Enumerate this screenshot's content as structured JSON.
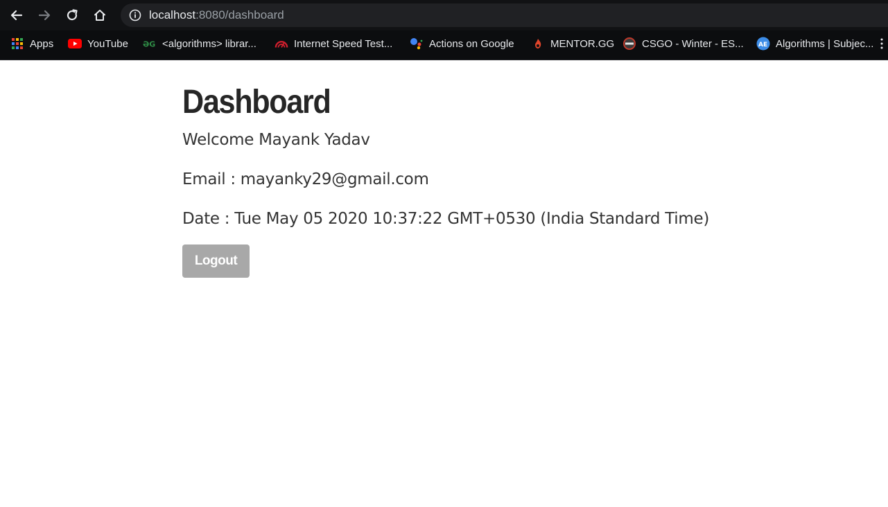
{
  "browser": {
    "url_host": "localhost",
    "url_path": ":8080/dashboard",
    "bookmarks": [
      {
        "label": "Apps",
        "icon": "apps-grid-icon"
      },
      {
        "label": "YouTube",
        "icon": "youtube-icon"
      },
      {
        "label": "<algorithms> librar...",
        "icon": "geeksforgeeks-icon"
      },
      {
        "label": "Internet Speed Test...",
        "icon": "speedtest-icon"
      },
      {
        "label": "Actions on Google",
        "icon": "google-assistant-icon"
      },
      {
        "label": "MENTOR.GG",
        "icon": "mentor-gg-icon"
      },
      {
        "label": "CSGO - Winter - ES...",
        "icon": "csgo-icon"
      },
      {
        "label": "Algorithms | Subjec...",
        "icon": "algorithms-icon"
      }
    ]
  },
  "dashboard": {
    "title": "Dashboard",
    "welcome": "Welcome Mayank Yadav",
    "email": "Email : mayanky29@gmail.com",
    "date": "Date : Tue May 05 2020 10:37:22 GMT+0530 (India Standard Time)",
    "logout_label": "Logout"
  },
  "colors": {
    "toolbar_bg": "#111214",
    "omnibox_bg": "#202124",
    "logout_button_bg": "#a8a8a8",
    "heading_text": "#262626"
  }
}
